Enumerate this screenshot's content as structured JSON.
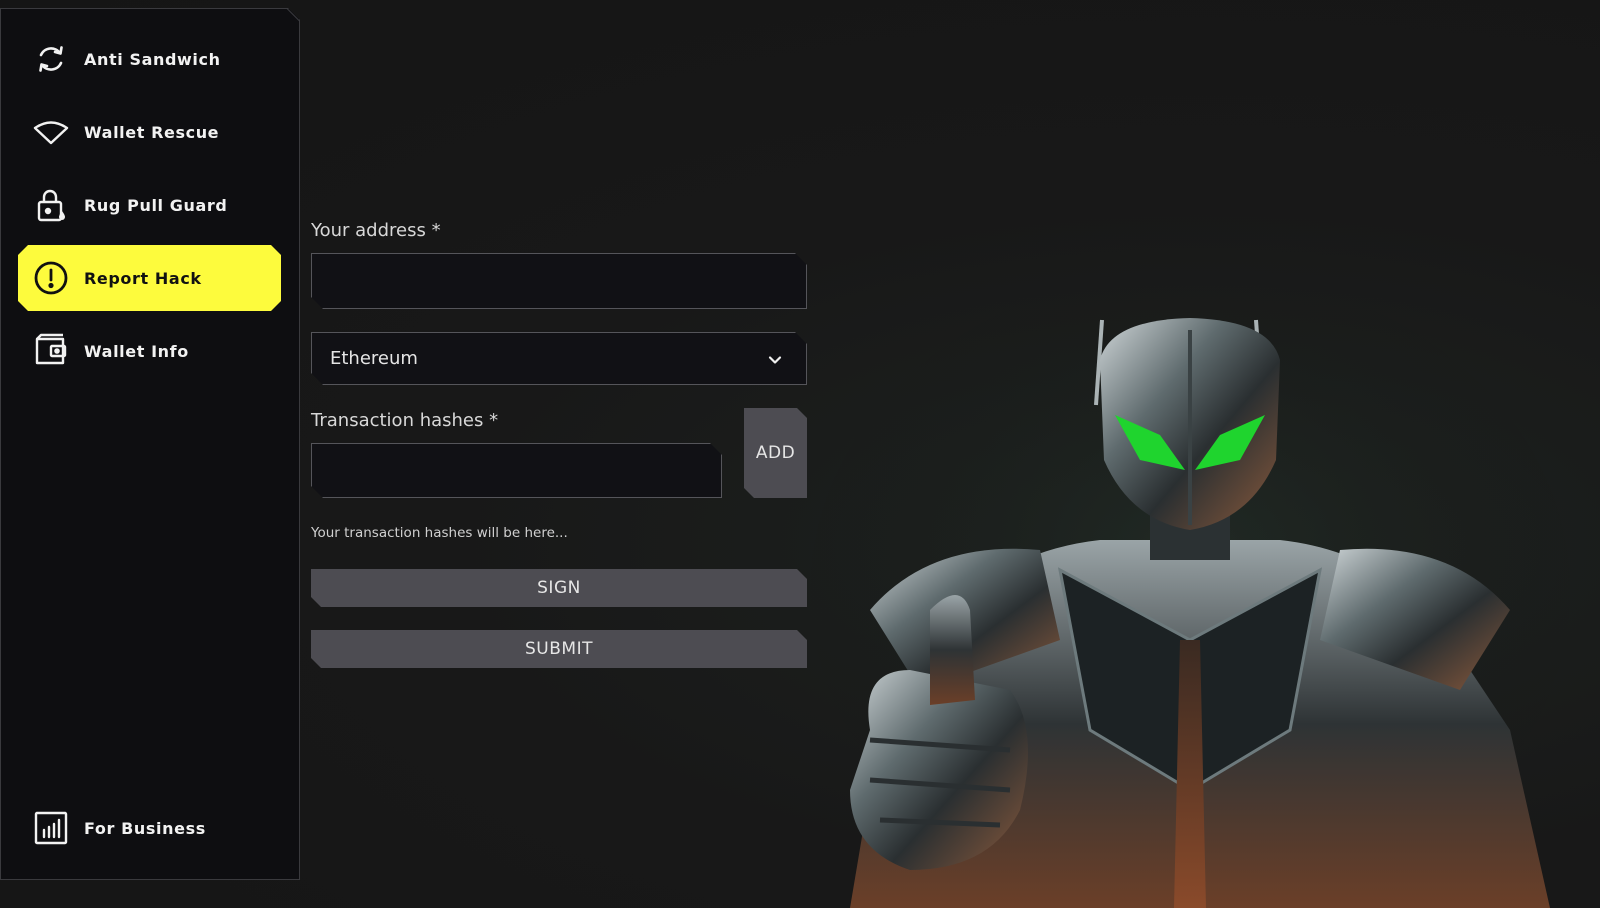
{
  "sidebar": {
    "items": [
      {
        "label": "Anti Sandwich",
        "icon": "refresh-icon"
      },
      {
        "label": "Wallet Rescue",
        "icon": "wifi-icon"
      },
      {
        "label": "Rug Pull Guard",
        "icon": "lock-icon"
      },
      {
        "label": "Report Hack",
        "icon": "alert-circle-icon",
        "active": true
      },
      {
        "label": "Wallet Info",
        "icon": "wallet-icon"
      }
    ],
    "footer": {
      "label": "For Business",
      "icon": "bar-chart-icon"
    }
  },
  "form": {
    "address_label": "Your address *",
    "address_value": "",
    "network_selected": "Ethereum",
    "hashes_label": "Transaction hashes *",
    "hashes_value": "",
    "add_label": "ADD",
    "hashes_hint": "Your transaction hashes will be here...",
    "sign_label": "SIGN",
    "submit_label": "SUBMIT"
  },
  "colors": {
    "accent": "#fdfb3d",
    "sidebar_bg": "#0e0e11",
    "button_bg": "#4d4c52",
    "robot_eyes": "#1fd42e"
  }
}
